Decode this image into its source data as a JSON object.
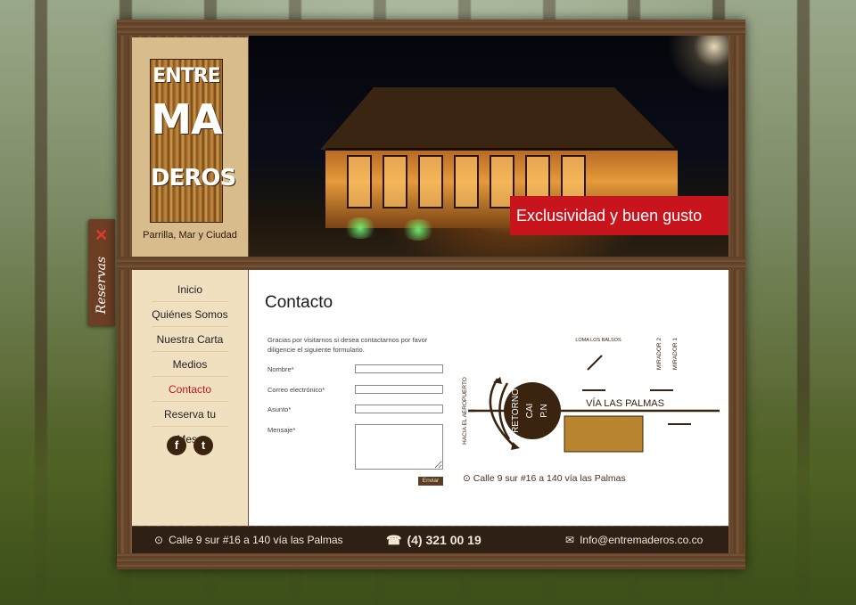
{
  "brand": {
    "logo_lines": [
      "ENTRE",
      "MA",
      "DEROS"
    ],
    "tagline": "Parrilla, Mar y Ciudad"
  },
  "hero": {
    "band_text": "Exclusividad y buen gusto"
  },
  "reservas": {
    "label": "Reservas",
    "close_glyph": "✕"
  },
  "nav": {
    "items": [
      {
        "label": "Inicio",
        "active": false
      },
      {
        "label": "Quiénes Somos",
        "active": false
      },
      {
        "label": "Nuestra Carta",
        "active": false
      },
      {
        "label": "Medios",
        "active": false
      },
      {
        "label": "Contacto",
        "active": true
      },
      {
        "label": "Reserva tu Mesa",
        "active": false
      }
    ],
    "social": [
      {
        "name": "facebook-icon",
        "glyph": "f"
      },
      {
        "name": "twitter-icon",
        "glyph": "t"
      }
    ]
  },
  "contact": {
    "title": "Contacto",
    "intro": "Gracias por visitarnos si desea contactarnos por favor diligencie el siguiente formulario.",
    "fields": {
      "nombre": "Nombre*",
      "correo": "Correo electrónico*",
      "asunto": "Asunto*",
      "mensaje": "Mensaje*"
    },
    "send_label": "Enviar"
  },
  "map": {
    "retorno": "RETORNO",
    "cai": "CAI",
    "pn": "P.N",
    "aeropuerto": "HACIA EL AEROPUERTO",
    "loma": "LOMA LOS BALSOS",
    "mirador2": "MIRADOR 2",
    "mirador1": "MIRADOR 1",
    "via": "VÍA LAS PALMAS",
    "address": "Calle 9 sur #16 a 140 vía las Palmas"
  },
  "footer": {
    "address": "Calle 9 sur #16 a 140 vía las Palmas",
    "phone": "(4) 321 00 19",
    "email": "Info@entremaderos.co.co"
  },
  "colors": {
    "accent_red": "#c8141c",
    "wood_dark": "#2e2015",
    "sidebar_bg": "#f1e0c0",
    "logo_panel": "#d9bc8c"
  }
}
